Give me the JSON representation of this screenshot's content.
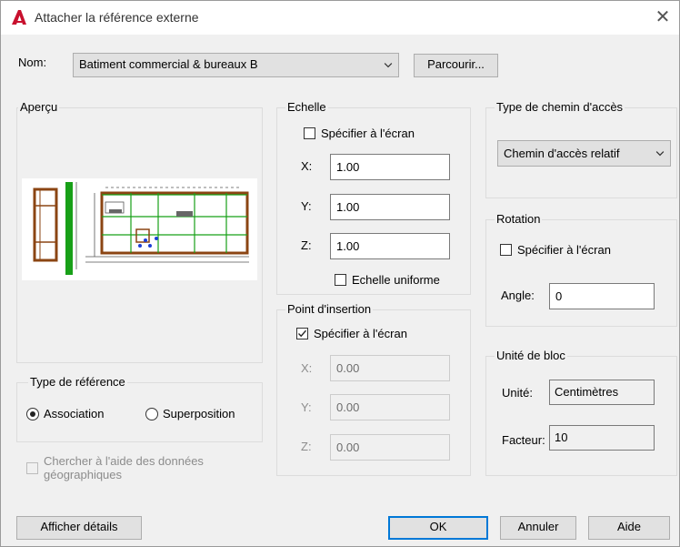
{
  "window": {
    "title": "Attacher la référence externe"
  },
  "name_row": {
    "label": "Nom:",
    "value": "Batiment commercial & bureaux B",
    "browse_label": "Parcourir..."
  },
  "preview": {
    "title": "Aperçu"
  },
  "scale": {
    "title": "Echelle",
    "specify_label": "Spécifier à l'écran",
    "specify_checked": false,
    "x_label": "X:",
    "x_value": "1.00",
    "y_label": "Y:",
    "y_value": "1.00",
    "z_label": "Z:",
    "z_value": "1.00",
    "uniform_label": "Echelle uniforme",
    "uniform_checked": false
  },
  "path_type": {
    "title": "Type de chemin d'accès",
    "value": "Chemin d'accès relatif"
  },
  "rotation": {
    "title": "Rotation",
    "specify_label": "Spécifier à l'écran",
    "angle_label": "Angle:",
    "angle_value": "0"
  },
  "insertion": {
    "title": "Point d'insertion",
    "specify_label": "Spécifier à l'écran",
    "specify_checked": true,
    "x_label": "X:",
    "x_value": "0.00",
    "y_label": "Y:",
    "y_value": "0.00",
    "z_label": "Z:",
    "z_value": "0.00"
  },
  "block_unit": {
    "title": "Unité de bloc",
    "unit_label": "Unité:",
    "unit_value": "Centimètres",
    "factor_label": "Facteur:",
    "factor_value": "10"
  },
  "ref_type": {
    "title": "Type de référence",
    "association_label": "Association",
    "overlay_label": "Superposition",
    "selected": "Association"
  },
  "geo": {
    "label": "Chercher à l'aide des données géographiques",
    "line1": "Chercher à l'aide des données",
    "line2": "géographiques"
  },
  "buttons": {
    "details": "Afficher détails",
    "ok": "OK",
    "cancel": "Annuler",
    "help": "Aide"
  },
  "colors": {
    "accent": "#0078d7",
    "autocad_red": "#c8102e"
  }
}
